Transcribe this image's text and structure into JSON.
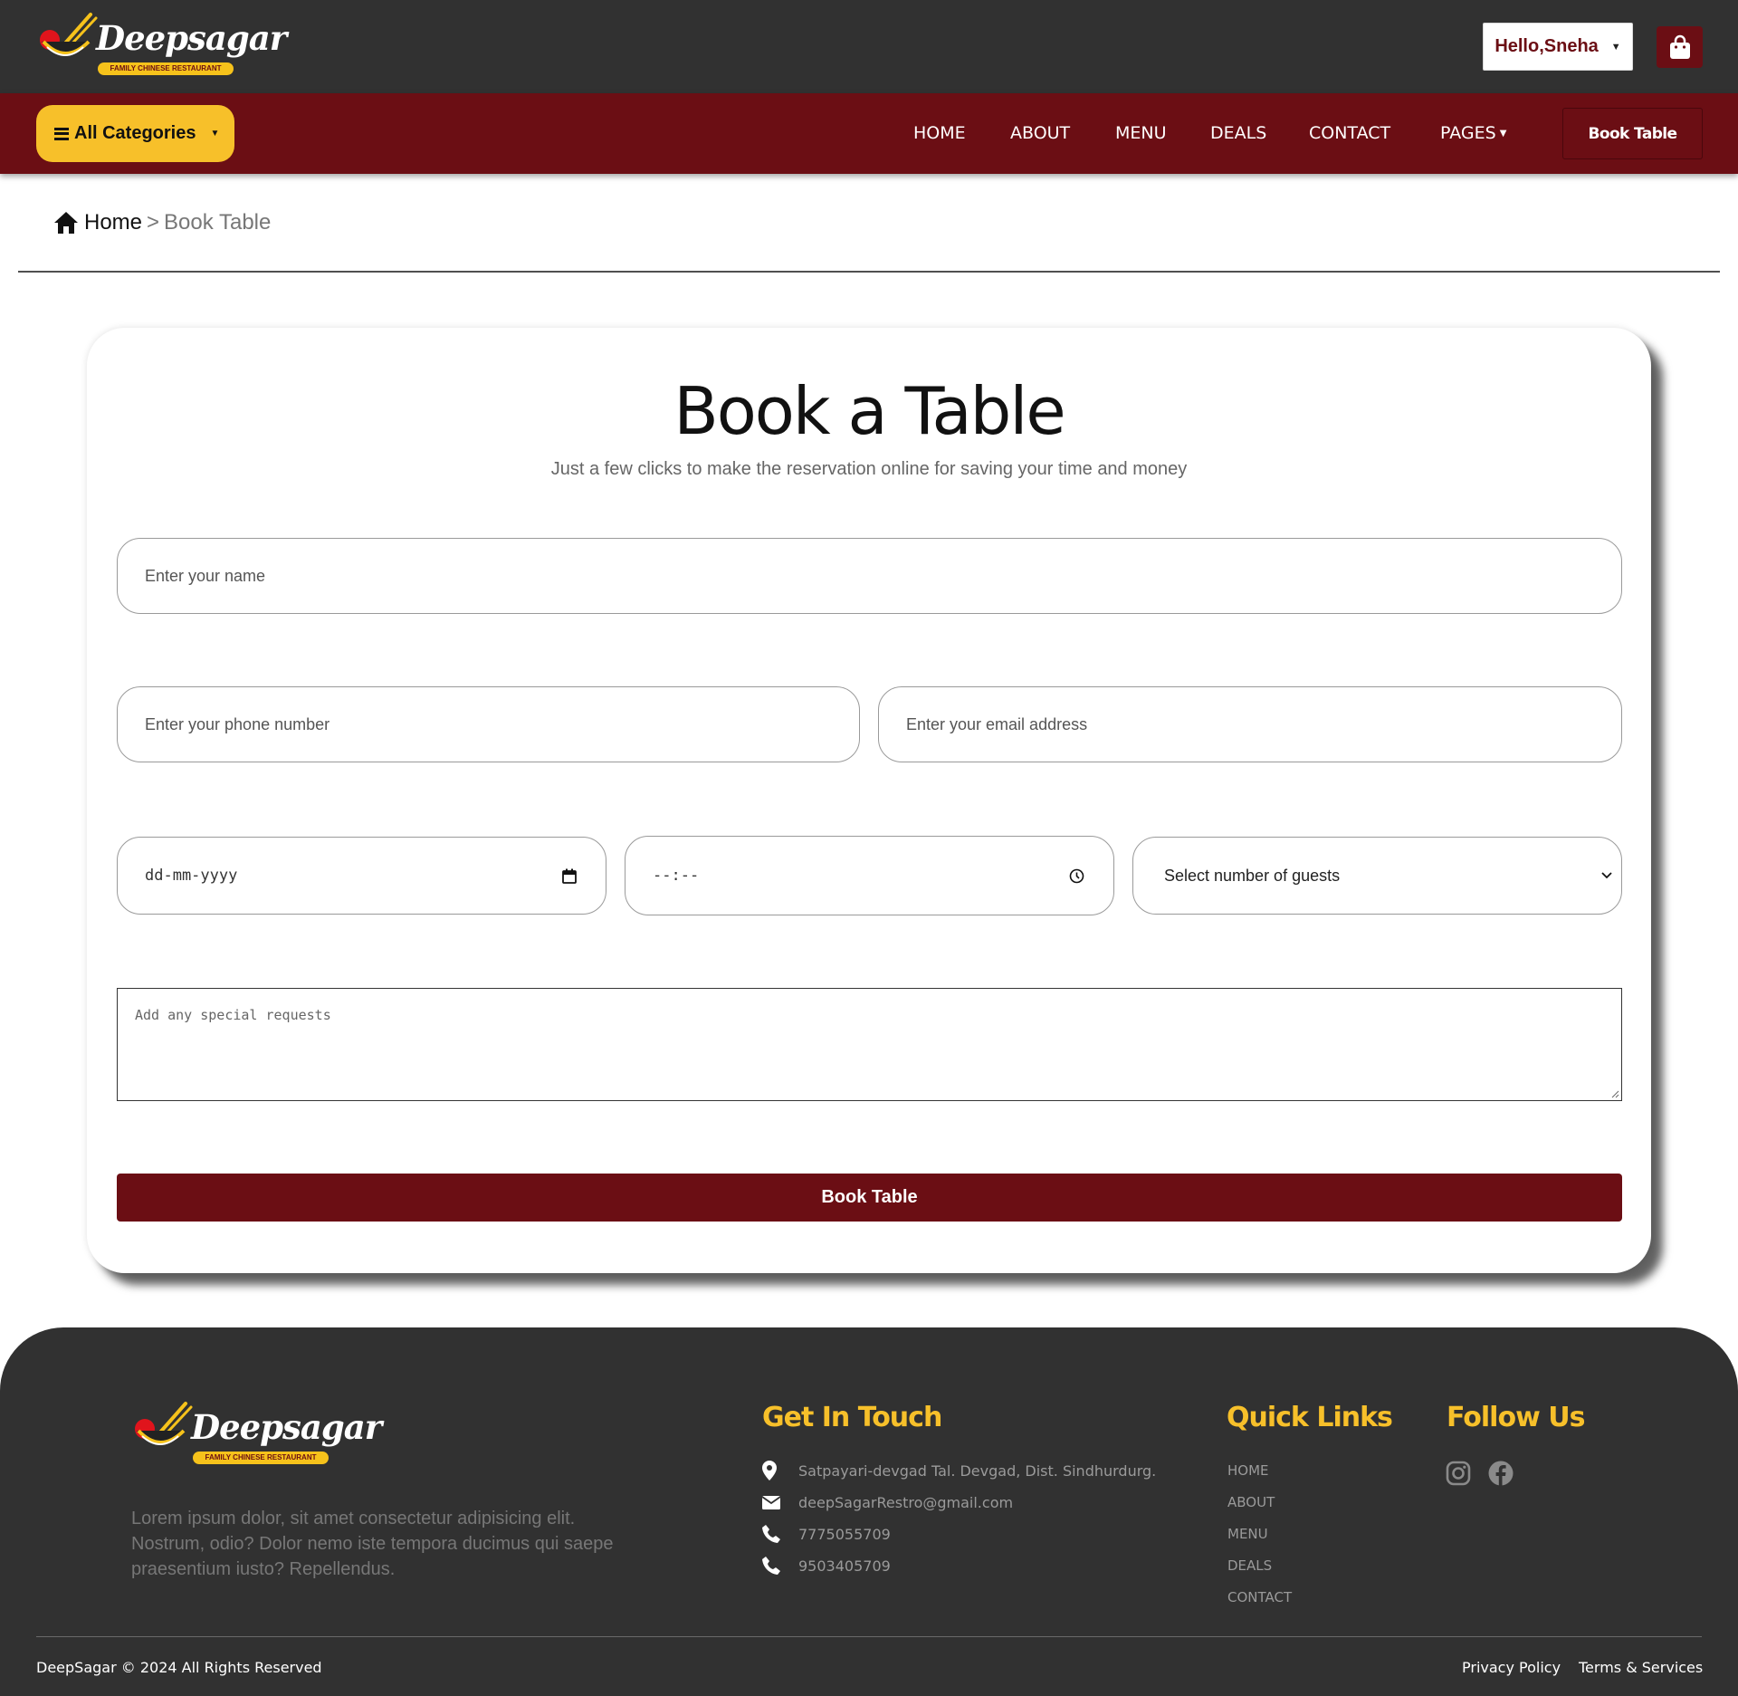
{
  "brand": {
    "name": "Deepsagar",
    "tagline": "FAMILY CHINESE RESTAURANT"
  },
  "header": {
    "user_greeting": "Hello,Sneha",
    "cart_icon": "shopping-bag-icon"
  },
  "nav": {
    "categories_label": "All Categories",
    "links": [
      "HOME",
      "ABOUT",
      "MENU",
      "DEALS",
      "CONTACT",
      "PAGES"
    ],
    "book_table_label": "Book Table"
  },
  "breadcrumb": {
    "home": "Home",
    "separator": ">",
    "current": "Book Table"
  },
  "booking": {
    "title": "Book a Table",
    "subtitle": "Just a few clicks to make the reservation online for saving your time and money",
    "name_placeholder": "Enter your name",
    "phone_placeholder": "Enter your phone number",
    "email_placeholder": "Enter your email address",
    "date_placeholder": "dd-mm-yyyy",
    "time_placeholder": "--:--",
    "guests_placeholder": "Select number of guests",
    "requests_placeholder": "Add any special requests",
    "submit_label": "Book Table"
  },
  "footer": {
    "description": "Lorem ipsum dolor, sit amet consectetur adipisicing elit. Nostrum, odio? Dolor nemo iste tempora ducimus qui saepe praesentium iusto? Repellendus.",
    "get_in_touch": {
      "heading": "Get In Touch",
      "address": "Satpayari-devgad Tal. Devgad, Dist. Sindhurdurg.",
      "email": "deepSagarRestro@gmail.com",
      "phones": [
        "7775055709",
        "9503405709"
      ]
    },
    "quick_links": {
      "heading": "Quick Links",
      "links": [
        "HOME",
        "ABOUT",
        "MENU",
        "DEALS",
        "CONTACT"
      ]
    },
    "follow_us": {
      "heading": "Follow Us",
      "icons": [
        "instagram-icon",
        "facebook-icon"
      ]
    },
    "copyright": "DeepSagar © 2024 All Rights Reserved",
    "privacy": "Privacy Policy",
    "terms": "Terms & Services"
  },
  "colors": {
    "header_bg": "#313131",
    "brand_maroon": "#6b0e14",
    "accent_yellow": "#f7c02a",
    "footer_bg": "#313131"
  }
}
